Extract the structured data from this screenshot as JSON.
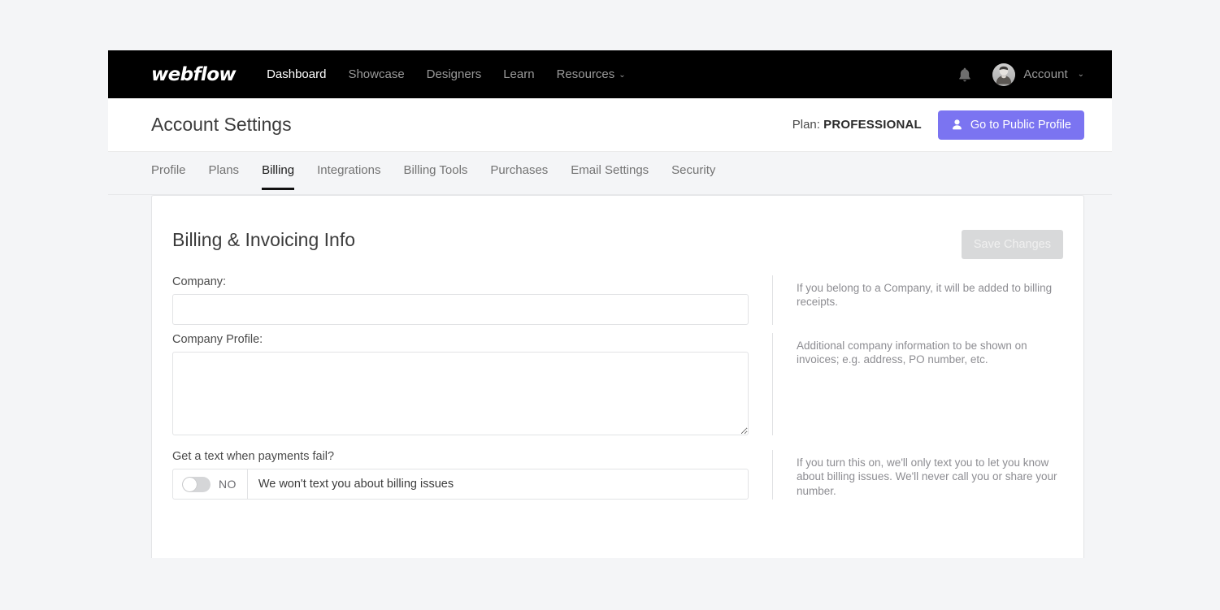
{
  "navbar": {
    "logo": "webflow",
    "links": [
      {
        "label": "Dashboard",
        "active": true
      },
      {
        "label": "Showcase",
        "active": false
      },
      {
        "label": "Designers",
        "active": false
      },
      {
        "label": "Learn",
        "active": false
      },
      {
        "label": "Resources",
        "active": false,
        "caret": "⌄"
      }
    ],
    "bell_icon": "bell-icon",
    "account_label": "Account",
    "account_caret": "⌄"
  },
  "header": {
    "title": "Account Settings",
    "plan_prefix": "Plan:",
    "plan_value": "PROFESSIONAL",
    "public_profile_button": "Go to Public Profile",
    "public_profile_icon": "person-icon",
    "accent_color": "#7b74f1"
  },
  "tabs": [
    {
      "label": "Profile",
      "active": false
    },
    {
      "label": "Plans",
      "active": false
    },
    {
      "label": "Billing",
      "active": true
    },
    {
      "label": "Integrations",
      "active": false
    },
    {
      "label": "Billing Tools",
      "active": false
    },
    {
      "label": "Purchases",
      "active": false
    },
    {
      "label": "Email Settings",
      "active": false
    },
    {
      "label": "Security",
      "active": false
    }
  ],
  "card": {
    "title": "Billing & Invoicing Info",
    "save_button": "Save Changes",
    "save_button_disabled": true,
    "fields": {
      "company": {
        "label": "Company:",
        "value": "",
        "placeholder": "",
        "help": "If you belong to a Company, it will be added to billing receipts."
      },
      "company_profile": {
        "label": "Company Profile:",
        "value": "",
        "placeholder": "",
        "help": "Additional company information to be shown on invoices; e.g. address, PO number, etc."
      },
      "text_alerts": {
        "label": "Get a text when payments fail?",
        "toggle_state": "NO",
        "toggle_on": false,
        "message": "We won't text you about billing issues",
        "help": "If you turn this on, we'll only text you to let you know about billing issues. We'll never call you or share your number."
      }
    }
  }
}
